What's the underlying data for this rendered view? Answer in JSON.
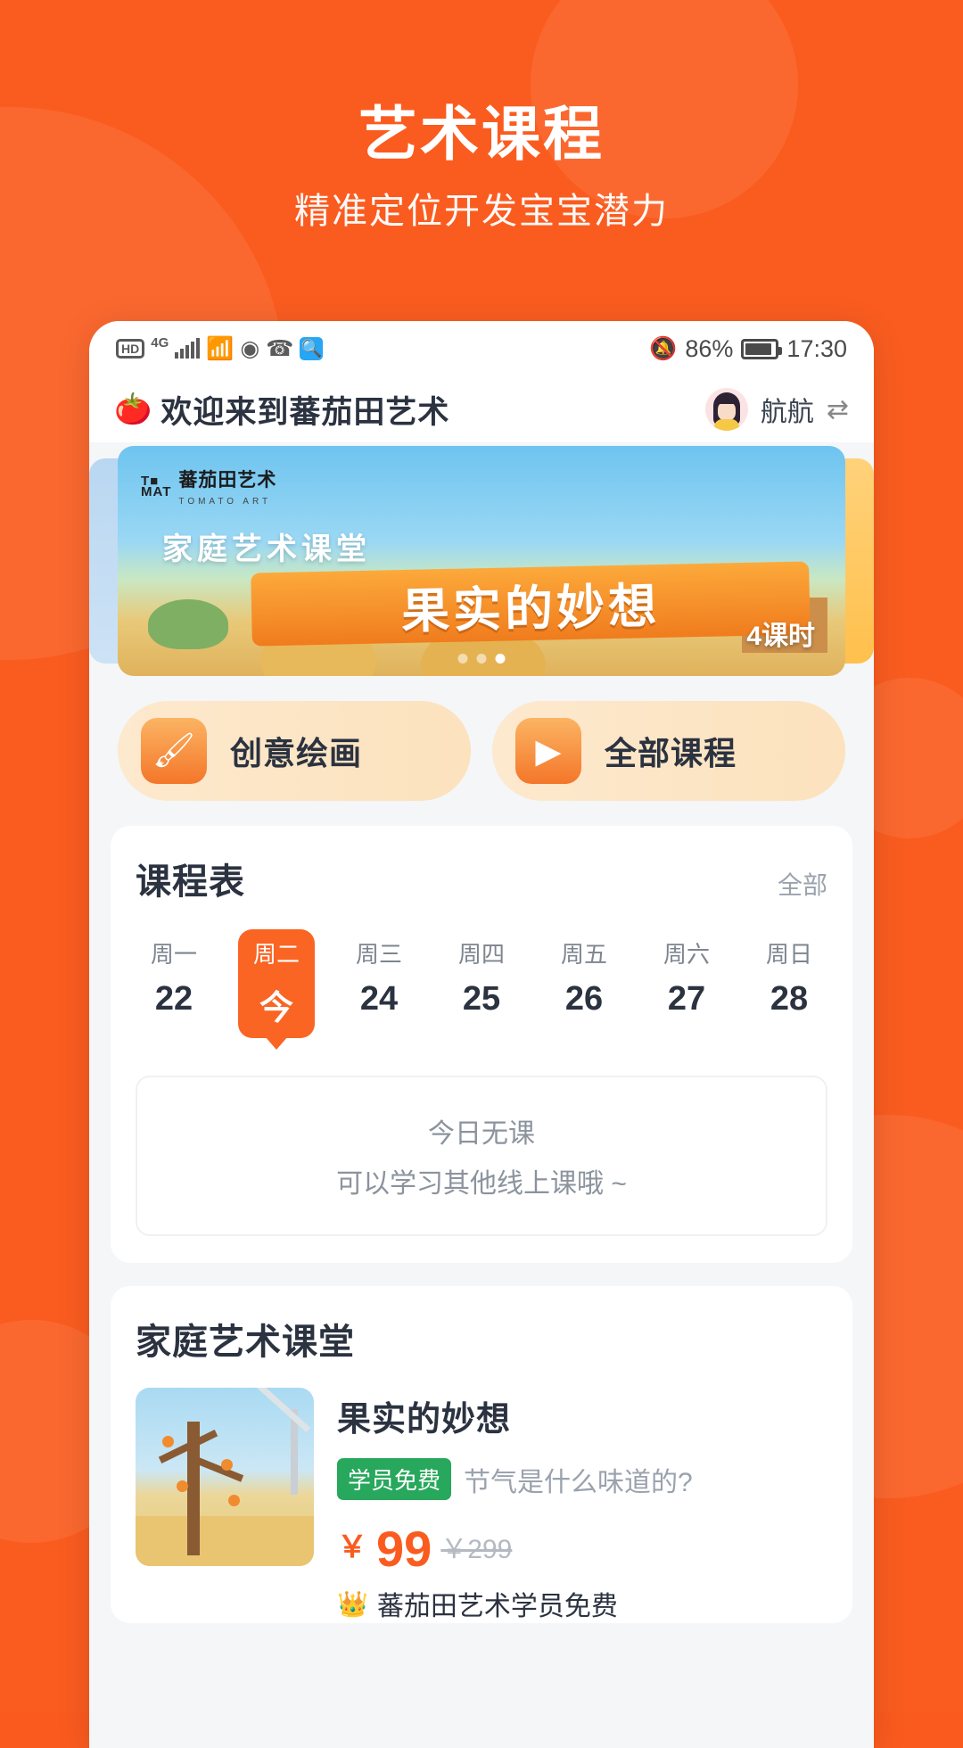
{
  "hero": {
    "title": "艺术课程",
    "subtitle": "精准定位开发宝宝潜力"
  },
  "theme": {
    "brand_orange": "#FA5C1F",
    "accent_orange": "#FA6523",
    "green_tag": "#27A85C",
    "muted_text": "#9aa2ad"
  },
  "status_bar": {
    "hd_label": "HD",
    "network_label": "4G",
    "signal_icon": "signal-bars-icon",
    "wifi_icon": "wifi-icon",
    "eye_icon": "eye-icon",
    "missed_call_icon": "missed-call-icon",
    "search_icon": "search-icon",
    "mute_icon": "bell-muted-icon",
    "battery_percent": "86%",
    "battery_icon": "battery-icon",
    "time": "17:30"
  },
  "app_header": {
    "brand_icon": "tomato-icon",
    "title": "欢迎来到蕃茄田艺术",
    "avatar_icon": "avatar",
    "user_name": "航航",
    "switch_icon": "switch-account-icon"
  },
  "banner": {
    "logo_mark": "T",
    "logo_mark2": "MAT",
    "logo_zh": "蕃茄田艺术",
    "logo_en": "TOMATO ART",
    "subtitle": "家庭艺术课堂",
    "title": "果实的妙想",
    "lessons": "4课时",
    "dots": 3,
    "active_dot": 3
  },
  "quick_actions": [
    {
      "icon": "paintbrush-icon",
      "glyph": "🖌",
      "label": "创意绘画"
    },
    {
      "icon": "play-course-icon",
      "glyph": "▶",
      "label": "全部课程"
    }
  ],
  "schedule": {
    "title": "课程表",
    "more_label": "全部",
    "days": [
      {
        "weekday": "周一",
        "date": "22",
        "active": false
      },
      {
        "weekday": "周二",
        "date": "今",
        "active": true
      },
      {
        "weekday": "周三",
        "date": "24",
        "active": false
      },
      {
        "weekday": "周四",
        "date": "25",
        "active": false
      },
      {
        "weekday": "周五",
        "date": "26",
        "active": false
      },
      {
        "weekday": "周六",
        "date": "27",
        "active": false
      },
      {
        "weekday": "周日",
        "date": "28",
        "active": false
      }
    ],
    "empty_line1": "今日无课",
    "empty_line2": "可以学习其他线上课哦 ~"
  },
  "family_class": {
    "title": "家庭艺术课堂",
    "course": {
      "thumb_icon": "course-thumbnail",
      "name": "果实的妙想",
      "tag": "学员免费",
      "desc": "节气是什么味道的?",
      "currency": "￥",
      "price": "99",
      "original_price": "￥299",
      "member_icon": "crown-icon",
      "member_text": "蕃茄田艺术学员免费"
    }
  }
}
